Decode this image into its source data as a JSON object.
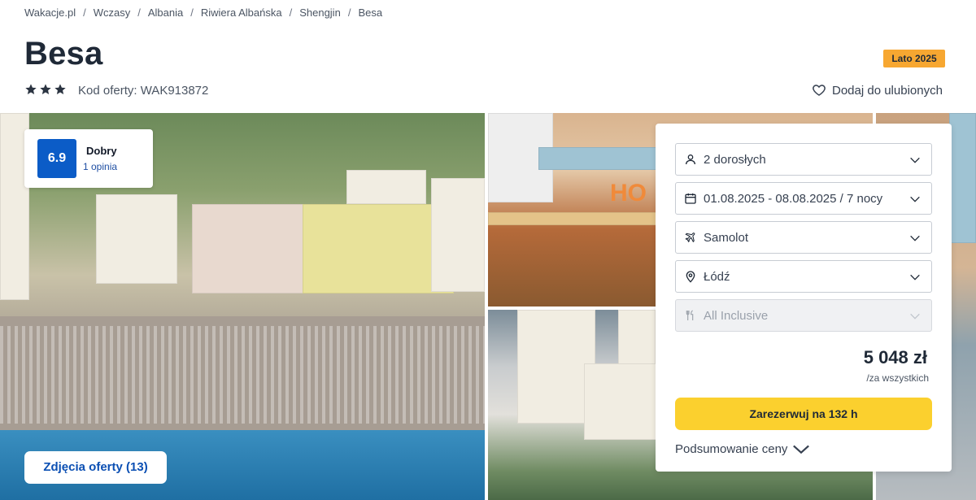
{
  "breadcrumb": [
    "Wakacje.pl",
    "Wczasy",
    "Albania",
    "Riwiera Albańska",
    "Shengjin",
    "Besa"
  ],
  "breadcrumb_separator": "/",
  "hotel": {
    "name": "Besa",
    "season_badge": "Lato 2025",
    "stars": 3,
    "offer_code": "Kod oferty: WAK913872"
  },
  "favorite_label": "Dodaj do ulubionych",
  "rating": {
    "score": "6.9",
    "label": "Dobry",
    "count": "1 opinia"
  },
  "photos_button": "Zdjęcia oferty (13)",
  "booking": {
    "travelers": "2 dorosłych",
    "dates": "01.08.2025 - 08.08.2025 / 7 nocy",
    "transport": "Samolot",
    "departure": "Łódź",
    "board": "All Inclusive",
    "price": "5 048 zł",
    "price_note": "/za wszystkich",
    "book_label": "Zarezerwuj na 132 h",
    "summary_label": "Podsumowanie ceny"
  },
  "icons": {
    "star": "star-icon",
    "heart": "heart-icon",
    "person": "person-icon",
    "calendar": "calendar-icon",
    "plane": "plane-icon",
    "location": "location-pin-icon",
    "food": "cutlery-icon",
    "chevron": "chevron-down-icon"
  },
  "colors": {
    "rating_bg": "#0b5cc7",
    "badge_bg": "#f7a731",
    "book_button_bg": "#fbd02e",
    "photos_button_text": "#0b4fb3"
  }
}
